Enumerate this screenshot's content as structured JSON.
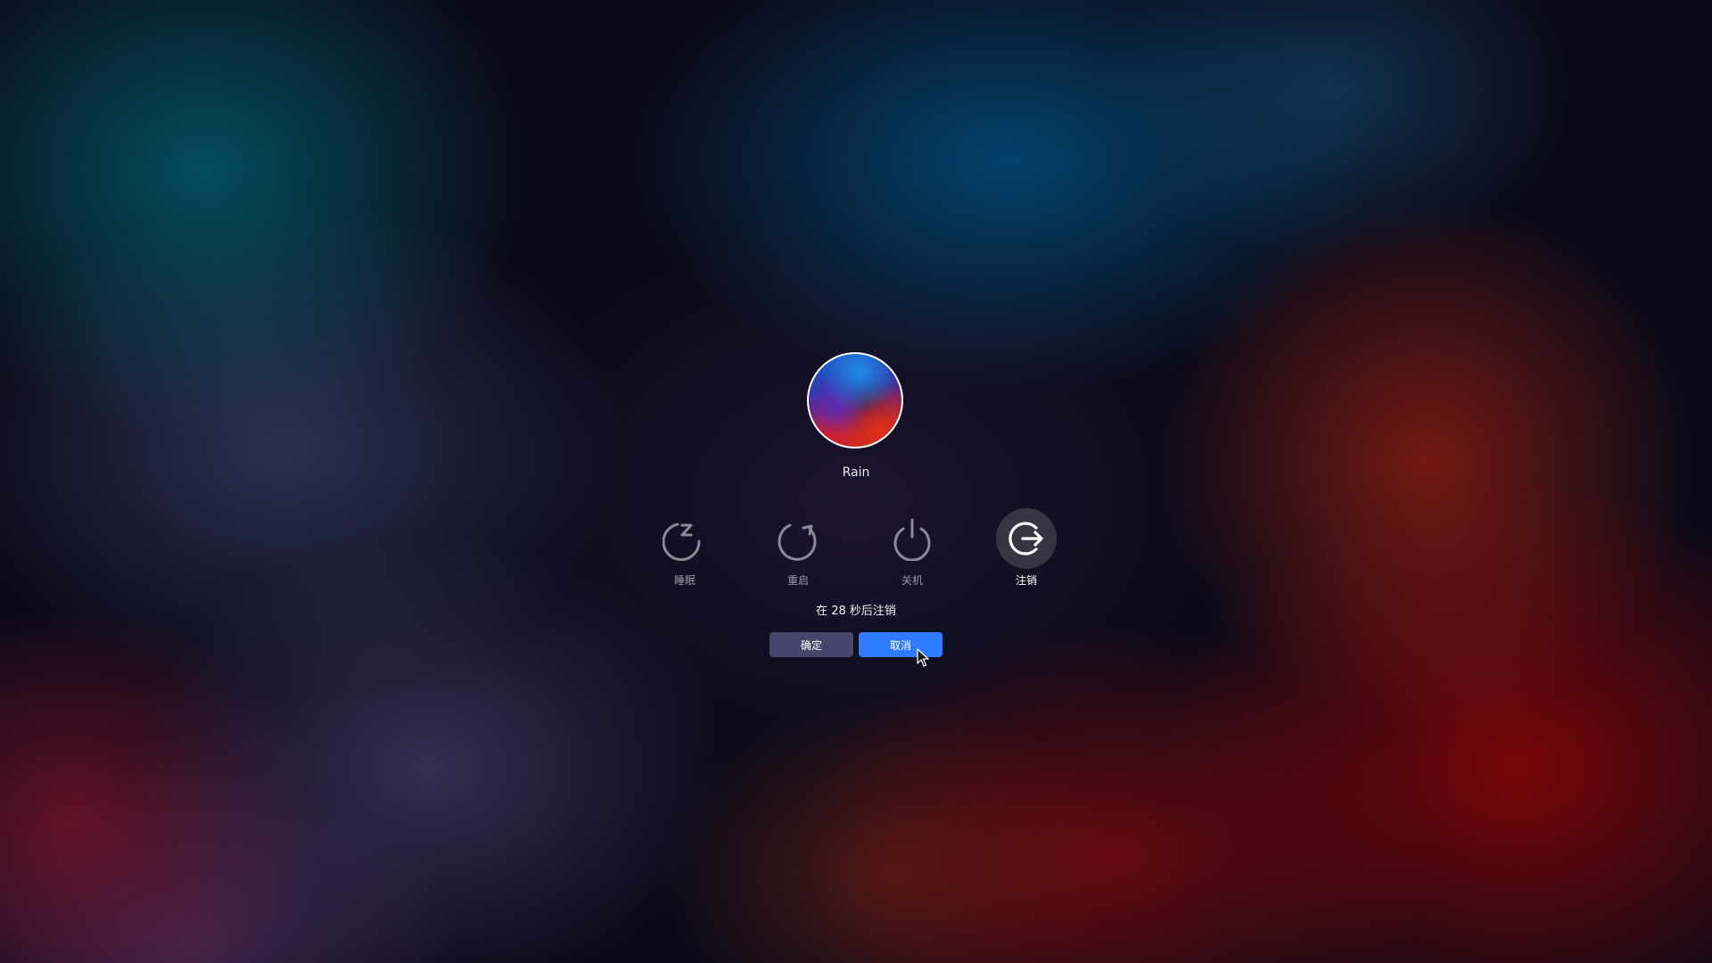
{
  "user": {
    "name": "Rain"
  },
  "actions": [
    {
      "id": "sleep",
      "label": "睡眠",
      "icon": "sleep-icon",
      "active": false
    },
    {
      "id": "restart",
      "label": "重启",
      "icon": "restart-icon",
      "active": false
    },
    {
      "id": "shutdown",
      "label": "关机",
      "icon": "power-icon",
      "active": false
    },
    {
      "id": "logout",
      "label": "注销",
      "icon": "logout-icon",
      "active": true
    }
  ],
  "countdown": {
    "text": "在 28 秒后注销"
  },
  "buttons": {
    "confirm_label": "确定",
    "cancel_label": "取消"
  },
  "colors": {
    "accent": "#2f7bff",
    "confirm_bg": "#50507a",
    "inactive_icon": "#8a8a96",
    "active_icon": "#ffffff"
  }
}
